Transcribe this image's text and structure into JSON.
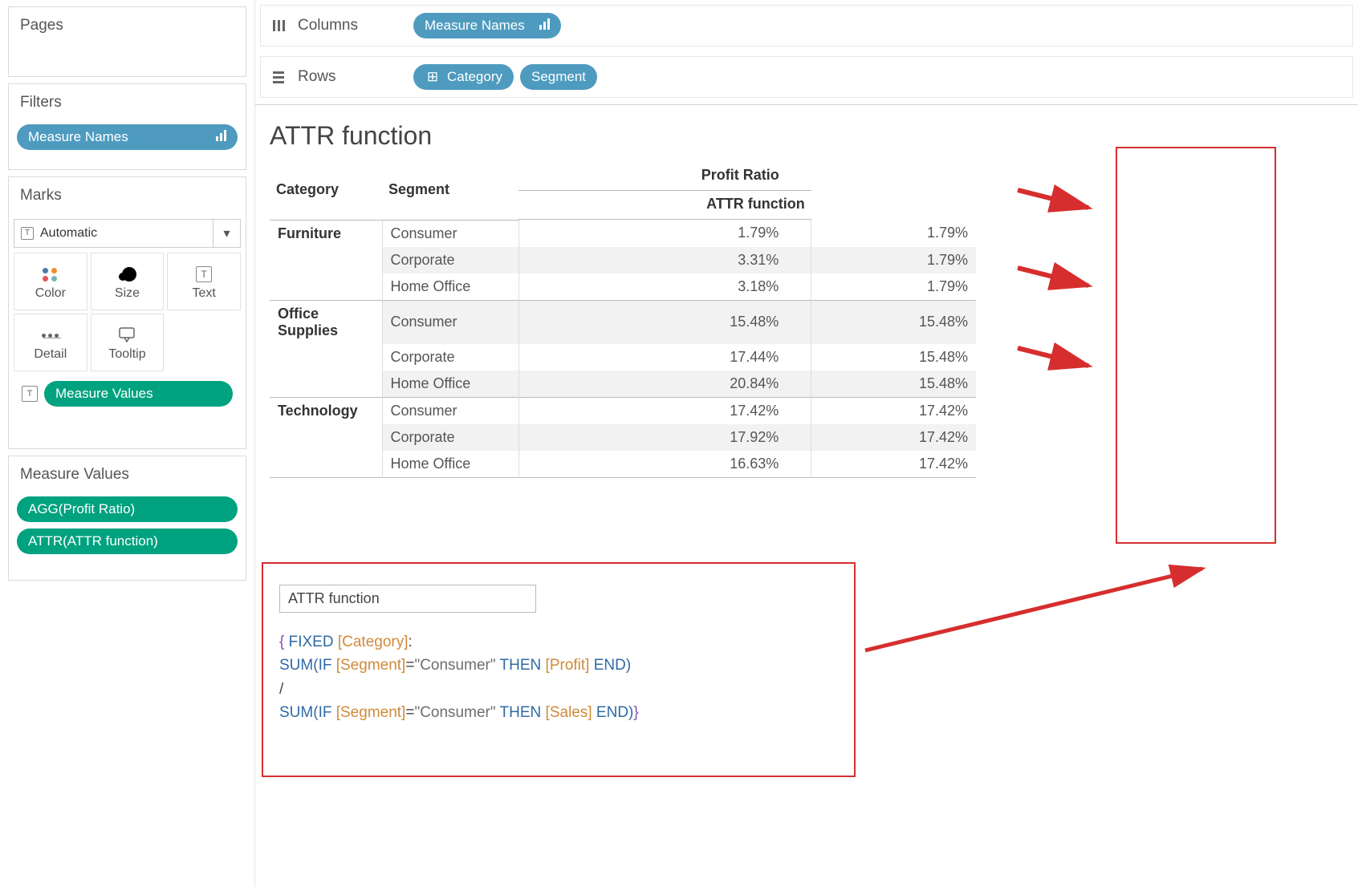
{
  "left": {
    "pages_title": "Pages",
    "filters_title": "Filters",
    "filter_pill": "Measure Names",
    "marks_title": "Marks",
    "marks_select": "Automatic",
    "mark_buttons": {
      "color": "Color",
      "size": "Size",
      "text": "Text",
      "detail": "Detail",
      "tooltip": "Tooltip"
    },
    "measure_values_pill": "Measure Values",
    "measure_values_title": "Measure Values",
    "mv_items": [
      "AGG(Profit Ratio)",
      "ATTR(ATTR function)"
    ]
  },
  "shelves": {
    "columns_label": "Columns",
    "rows_label": "Rows",
    "columns_pill": "Measure Names",
    "rows_pill1": "Category",
    "rows_pill2": "Segment"
  },
  "viz": {
    "title": "ATTR function",
    "headers": {
      "category": "Category",
      "segment": "Segment",
      "col1": "Profit Ratio",
      "col2": "ATTR function"
    },
    "rows": [
      {
        "category": "Furniture",
        "segment": "Consumer",
        "c1": "1.79%",
        "c2": "1.79%"
      },
      {
        "category": "",
        "segment": "Corporate",
        "c1": "3.31%",
        "c2": "1.79%"
      },
      {
        "category": "",
        "segment": "Home Office",
        "c1": "3.18%",
        "c2": "1.79%"
      },
      {
        "category": "Office Supplies",
        "segment": "Consumer",
        "c1": "15.48%",
        "c2": "15.48%"
      },
      {
        "category": "",
        "segment": "Corporate",
        "c1": "17.44%",
        "c2": "15.48%"
      },
      {
        "category": "",
        "segment": "Home Office",
        "c1": "20.84%",
        "c2": "15.48%"
      },
      {
        "category": "Technology",
        "segment": "Consumer",
        "c1": "17.42%",
        "c2": "17.42%"
      },
      {
        "category": "",
        "segment": "Corporate",
        "c1": "17.92%",
        "c2": "17.42%"
      },
      {
        "category": "",
        "segment": "Home Office",
        "c1": "16.63%",
        "c2": "17.42%"
      }
    ]
  },
  "calc": {
    "name": "ATTR function",
    "line1a": "{ ",
    "line1b": "FIXED",
    "line1c": " [Category]",
    "line1d": ":",
    "line2a": "SUM(",
    "line2b": "IF",
    "line2c": " [Segment]",
    "line2d": "=",
    "line2e": "\"Consumer\"",
    "line2f": " THEN",
    "line2g": " [Profit]",
    "line2h": " END",
    "line2i": ")",
    "line3": "/",
    "line4a": "SUM(",
    "line4b": "IF",
    "line4c": " [Segment]",
    "line4d": "=",
    "line4e": "\"Consumer\"",
    "line4f": " THEN",
    "line4g": " [Sales]",
    "line4h": " END",
    "line4i": ")",
    "line4j": "}"
  },
  "chart_data": {
    "type": "table",
    "columns": [
      "Category",
      "Segment",
      "Profit Ratio",
      "ATTR function"
    ],
    "rows": [
      [
        "Furniture",
        "Consumer",
        0.0179,
        0.0179
      ],
      [
        "Furniture",
        "Corporate",
        0.0331,
        0.0179
      ],
      [
        "Furniture",
        "Home Office",
        0.0318,
        0.0179
      ],
      [
        "Office Supplies",
        "Consumer",
        0.1548,
        0.1548
      ],
      [
        "Office Supplies",
        "Corporate",
        0.1744,
        0.1548
      ],
      [
        "Office Supplies",
        "Home Office",
        0.2084,
        0.1548
      ],
      [
        "Technology",
        "Consumer",
        0.1742,
        0.1742
      ],
      [
        "Technology",
        "Corporate",
        0.1792,
        0.1742
      ],
      [
        "Technology",
        "Home Office",
        0.1663,
        0.1742
      ]
    ],
    "title": "ATTR function"
  },
  "colors": {
    "pill_blue": "#4e9bbf",
    "pill_green": "#00a27f",
    "annotation_red": "#d62e2e"
  }
}
